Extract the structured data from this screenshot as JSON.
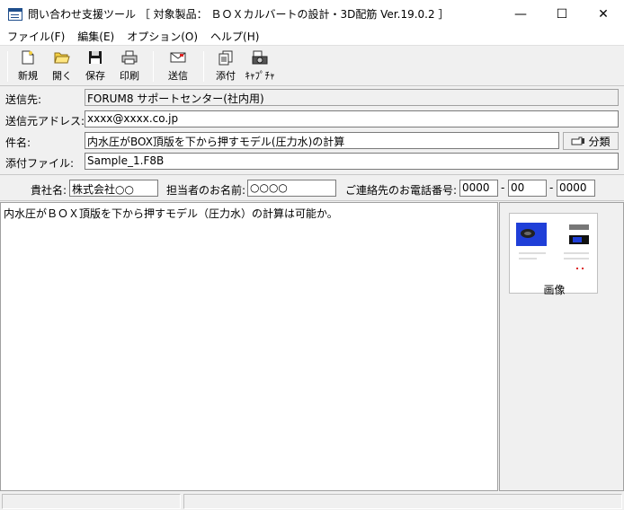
{
  "window": {
    "title": "問い合わせ支援ツール ［ 対象製品： ＢＯＸカルバートの設計・3D配筋 Ver.19.0.2 ］",
    "minimize_glyph": "—",
    "maximize_glyph": "☐",
    "close_glyph": "✕"
  },
  "menu": {
    "items": [
      "ファイル(F)",
      "編集(E)",
      "オプション(O)",
      "ヘルプ(H)"
    ]
  },
  "toolbar": {
    "new_label": "新規",
    "open_label": "開く",
    "save_label": "保存",
    "print_label": "印刷",
    "send_label": "送信",
    "attach_label": "添付",
    "capture_label": "ｷｬﾌﾟﾁｬ"
  },
  "form": {
    "to_label": "送信先:",
    "to_value": "FORUM8 サポートセンター(社内用)",
    "from_label": "送信元アドレス:",
    "from_value": "xxxx@xxxx.co.jp",
    "subject_label": "件名:",
    "subject_value": "内水圧がBOX頂版を下から押すモデル(圧力水)の計算",
    "classify_button": "分類",
    "attach_label": "添付ファイル:",
    "attach_value": "Sample_1.F8B"
  },
  "contact": {
    "company_label": "貴社名:",
    "company_value": "株式会社○○",
    "person_label": "担当者のお名前:",
    "person_value": "○○○○",
    "phone_label": "ご連絡先のお電話番号:",
    "phone_1": "0000",
    "phone_2": "00",
    "phone_3": "0000",
    "dash": "-"
  },
  "body": {
    "text": "内水圧がＢＯＸ頂版を下から押すモデル（圧力水）の計算は可能か。"
  },
  "attachment": {
    "thumbnail_caption": "画像"
  },
  "colors": {
    "accent_blue": "#1f3fd8",
    "window_bg": "#f0f0f0"
  }
}
